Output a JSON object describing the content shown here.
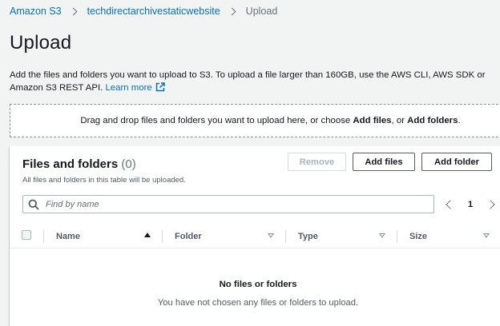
{
  "breadcrumb": {
    "items": [
      "Amazon S3",
      "techdirectarchivestaticwebsite"
    ],
    "current": "Upload"
  },
  "page": {
    "title": "Upload",
    "description": "Add the files and folders you want to upload to S3. To upload a file larger than 160GB, use the AWS CLI, AWS SDK or Amazon S3 REST API.",
    "learn_more": "Learn more",
    "learn_more_icon": "external-link-icon"
  },
  "dropzone": {
    "text_before": "Drag and drop files and folders you want to upload here, or choose ",
    "add_files": "Add files",
    "text_middle": ", or ",
    "add_folders": "Add folders",
    "text_after": "."
  },
  "panel": {
    "title": "Files and folders",
    "count": "(0)",
    "description": "All files and folders in this table will be uploaded.",
    "buttons": {
      "remove": "Remove",
      "add_files": "Add files",
      "add_folder": "Add folder"
    },
    "search": {
      "placeholder": "Find by name",
      "icon": "search-icon"
    },
    "pagination": {
      "current_page": "1"
    },
    "columns": [
      "Name",
      "Folder",
      "Type",
      "Size"
    ],
    "sort": {
      "active_column": "Name",
      "direction": "ascending"
    },
    "empty": {
      "title": "No files or folders",
      "description": "You have not chosen any files or folders to upload."
    }
  },
  "colors": {
    "link": "#0073bb",
    "background": "#f2f3f3",
    "text": "#16191f",
    "secondary_text": "#545b64"
  }
}
